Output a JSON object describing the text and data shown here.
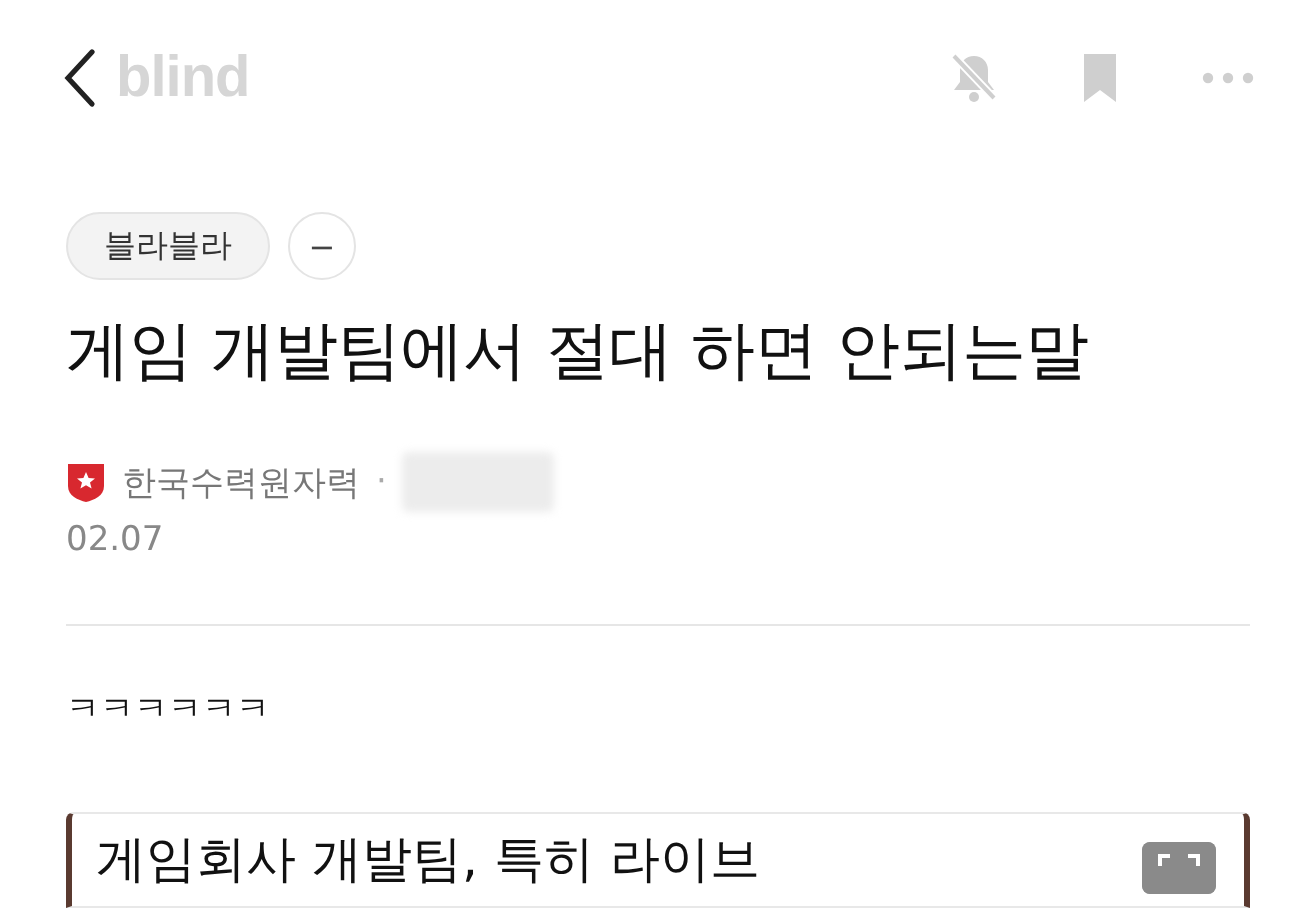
{
  "header": {
    "logo": "blind",
    "bell_muted": true
  },
  "post": {
    "category": "블라블라",
    "category_action": "−",
    "title": "게임 개발팀에서 절대 하면 안되는말",
    "author": {
      "company": "한국수력원자력",
      "separator": "·"
    },
    "date": "02.07",
    "body": "ㅋㅋㅋㅋㅋㅋ",
    "embedded_card": {
      "title": "게임회사 개발팀, 특히 라이브"
    }
  }
}
